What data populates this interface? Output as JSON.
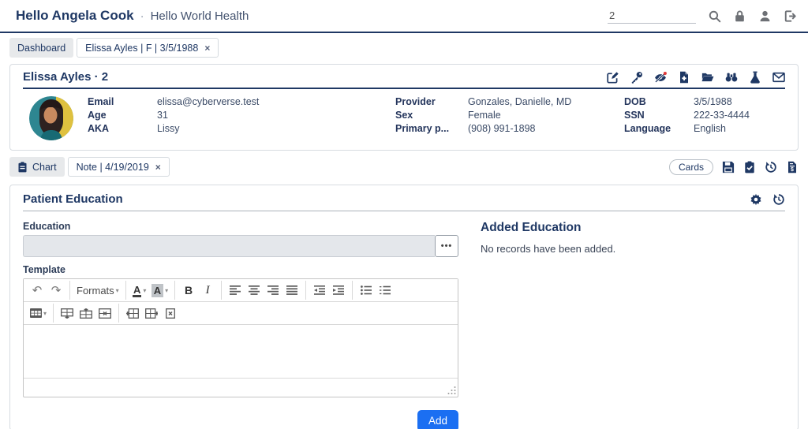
{
  "header": {
    "user_greeting": "Hello Angela Cook",
    "separator": "·",
    "org_name": "Hello World Health",
    "search_value": "2"
  },
  "glyphs": {
    "close": "×",
    "undo": "↶",
    "redo": "↷",
    "caret": "▾",
    "ellipsis": "•••"
  },
  "workspace_tabs": [
    {
      "label": "Dashboard"
    },
    {
      "label": "Elissa Ayles | F | 3/5/1988"
    }
  ],
  "patient_card": {
    "title": "Elissa Ayles · 2",
    "icons": [
      "edit-icon",
      "key-icon",
      "eye-slash-icon",
      "file-medical-icon",
      "folder-open-icon",
      "binoculars-icon",
      "flask-icon",
      "envelope-icon"
    ],
    "fields": {
      "col1": [
        {
          "label": "Email",
          "value": "elissa@cyberverse.test"
        },
        {
          "label": "Age",
          "value": "31"
        },
        {
          "label": "AKA",
          "value": "Lissy"
        }
      ],
      "col2": [
        {
          "label": "Provider",
          "value": "Gonzales, Danielle, MD"
        },
        {
          "label": "Sex",
          "value": "Female"
        },
        {
          "label": "Primary p...",
          "value": "(908) 991-1898"
        }
      ],
      "col3": [
        {
          "label": "DOB",
          "value": "3/5/1988"
        },
        {
          "label": "SSN",
          "value": "222-33-4444"
        },
        {
          "label": "Language",
          "value": "English"
        }
      ]
    }
  },
  "chart_tabs": {
    "chart_tab": "Chart",
    "note_tab": "Note | 4/19/2019",
    "cards_button": "Cards",
    "icons": [
      "save-icon",
      "clipboard-check-icon",
      "history-icon",
      "file-invoice-icon"
    ]
  },
  "panel": {
    "title": "Patient Education",
    "header_icons": [
      "gear-icon",
      "history-icon"
    ],
    "education_label": "Education",
    "education_value": "",
    "template_label": "Template",
    "toolbar": {
      "formats": "Formats",
      "text_color": "A",
      "back_color": "A",
      "bold": "B",
      "italic": "I"
    },
    "added": {
      "title": "Added Education",
      "empty_text": "No records have been added."
    },
    "add_button": "Add"
  },
  "colors": {
    "navy": "#1f3864",
    "accent_blue": "#1b6ff2",
    "alert_red": "#e23b3b",
    "tab_gray": "#e7e9eb"
  }
}
